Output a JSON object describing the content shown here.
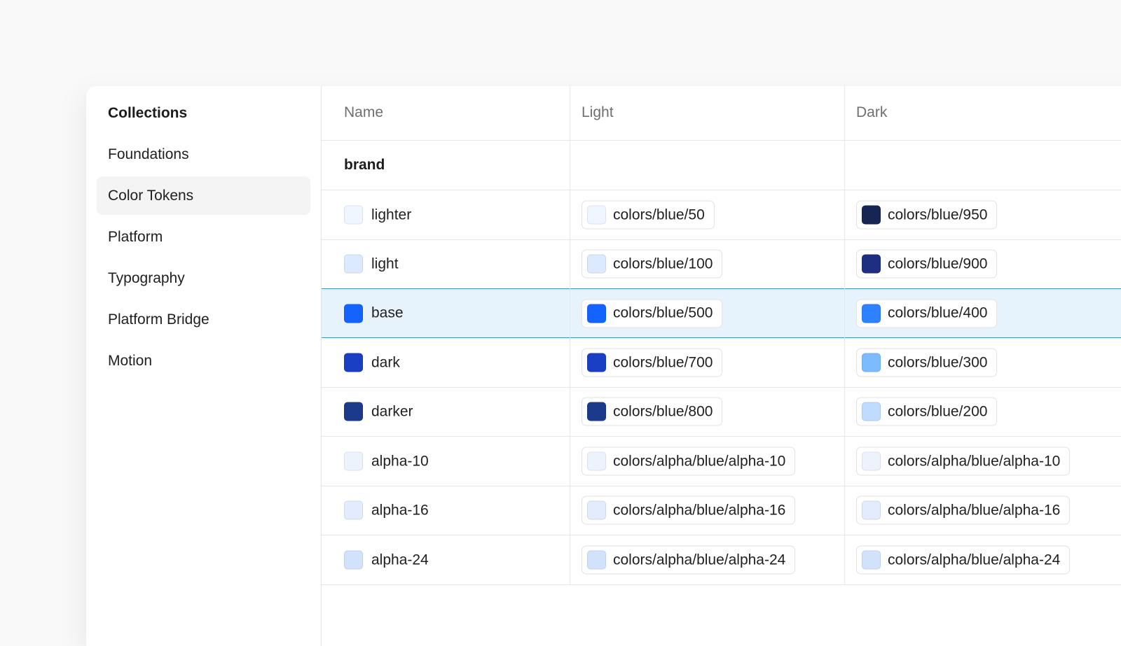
{
  "sidebar": {
    "title": "Collections",
    "items": [
      {
        "label": "Foundations",
        "active": false
      },
      {
        "label": "Color Tokens",
        "active": true
      },
      {
        "label": "Platform",
        "active": false
      },
      {
        "label": "Typography",
        "active": false
      },
      {
        "label": "Platform Bridge",
        "active": false
      },
      {
        "label": "Motion",
        "active": false
      }
    ]
  },
  "table": {
    "columns": [
      "Name",
      "Light",
      "Dark"
    ],
    "group": "brand",
    "selected_row": "base",
    "rows": [
      {
        "name": "lighter",
        "swatch": "#eff6ff",
        "light": {
          "token": "colors/blue/50",
          "color": "#eff6ff"
        },
        "dark": {
          "token": "colors/blue/950",
          "color": "#172554"
        }
      },
      {
        "name": "light",
        "swatch": "#dbeafe",
        "light": {
          "token": "colors/blue/100",
          "color": "#dbeafe"
        },
        "dark": {
          "token": "colors/blue/900",
          "color": "#1e2f82"
        }
      },
      {
        "name": "base",
        "swatch": "#1463ff",
        "light": {
          "token": "colors/blue/500",
          "color": "#1463ff"
        },
        "dark": {
          "token": "colors/blue/400",
          "color": "#2f82ff"
        }
      },
      {
        "name": "dark",
        "swatch": "#1a3ec4",
        "light": {
          "token": "colors/blue/700",
          "color": "#1a3ec4"
        },
        "dark": {
          "token": "colors/blue/300",
          "color": "#7dbbff"
        }
      },
      {
        "name": "darker",
        "swatch": "#1b3a8c",
        "light": {
          "token": "colors/blue/800",
          "color": "#1b3a8c"
        },
        "dark": {
          "token": "colors/blue/200",
          "color": "#bfdbfe"
        }
      },
      {
        "name": "alpha-10",
        "swatch": "#edf3fd",
        "light": {
          "token": "colors/alpha/blue/alpha-10",
          "color": "#edf3fd"
        },
        "dark": {
          "token": "colors/alpha/blue/alpha-10",
          "color": "#edf3fd"
        }
      },
      {
        "name": "alpha-16",
        "swatch": "#e2ecfc",
        "light": {
          "token": "colors/alpha/blue/alpha-16",
          "color": "#e2ecfc"
        },
        "dark": {
          "token": "colors/alpha/blue/alpha-16",
          "color": "#e2ecfc"
        }
      },
      {
        "name": "alpha-24",
        "swatch": "#d2e2fb",
        "light": {
          "token": "colors/alpha/blue/alpha-24",
          "color": "#d2e2fb"
        },
        "dark": {
          "token": "colors/alpha/blue/alpha-24",
          "color": "#d2e2fb"
        }
      }
    ]
  }
}
